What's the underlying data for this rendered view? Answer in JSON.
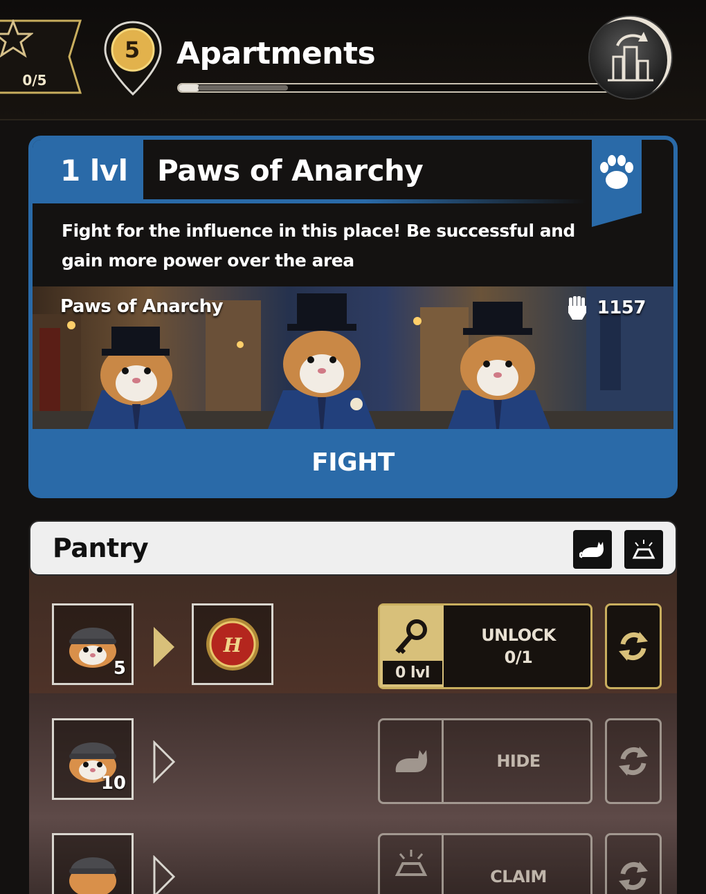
{
  "header": {
    "stars_count": "0/5",
    "location_level": "5",
    "location_name": "Apartments",
    "location_progress": 0.05
  },
  "fight_card": {
    "level": "1 lvl",
    "title": "Paws of Anarchy",
    "description": "Fight for the influence in this place! Be successful and gain more power over the area",
    "scene_label": "Paws of Anarchy",
    "power": "1157",
    "fight_label": "FIGHT",
    "accent_color": "#2a6aa8"
  },
  "pantry": {
    "title": "Pantry",
    "rows": [
      {
        "slot_count": "5",
        "action_label": "UNLOCK",
        "action_sub": "0/1",
        "action_level": "0 lvl",
        "icon": "key-icon",
        "active": true
      },
      {
        "slot_count": "10",
        "action_label": "HIDE",
        "action_sub": "",
        "icon": "cat-icon",
        "active": false
      },
      {
        "slot_count": "",
        "action_label": "CLAIM",
        "action_sub": "",
        "icon": "gold-icon",
        "active": false
      }
    ]
  }
}
